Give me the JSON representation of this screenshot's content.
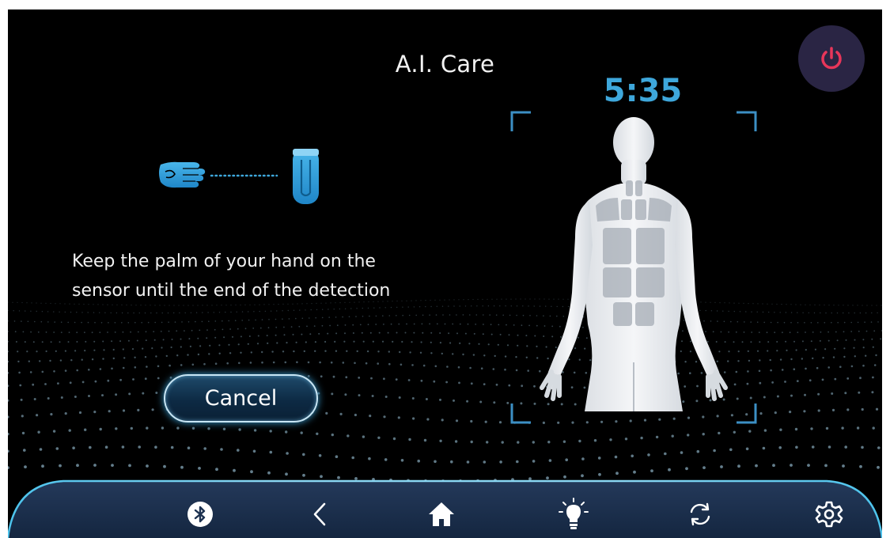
{
  "header": {
    "title": "A.I. Care",
    "timer": "5:35"
  },
  "instruction": {
    "line1": "Keep the palm of your hand on the",
    "line2": "sensor until the end of the detection"
  },
  "actions": {
    "cancel_label": "Cancel"
  },
  "nav": {
    "items": [
      {
        "icon": "bluetooth-icon"
      },
      {
        "icon": "back-icon"
      },
      {
        "icon": "home-icon"
      },
      {
        "icon": "lightbulb-icon"
      },
      {
        "icon": "sync-icon"
      },
      {
        "icon": "settings-icon"
      }
    ]
  },
  "colors": {
    "background": "#000000",
    "accent_blue": "#3ea7db",
    "power_red": "#e8365a",
    "nav_bar": "#1c3150"
  }
}
